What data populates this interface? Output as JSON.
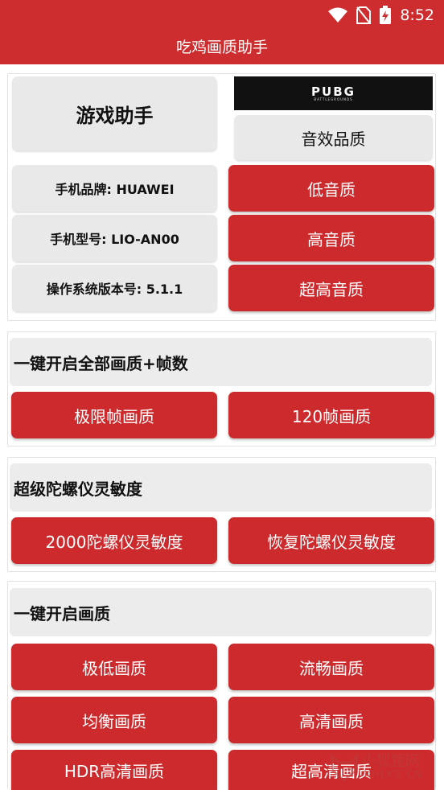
{
  "status": {
    "time": "8:52"
  },
  "app": {
    "title": "吃鸡画质助手"
  },
  "device": {
    "title": "游戏助手",
    "brand": "手机品牌: HUAWEI",
    "model": "手机型号: LIO-AN00",
    "os": "操作系统版本号: 5.1.1"
  },
  "banner": {
    "logo_text": "PUBG",
    "sub_text": "BATTLEGROUNDS"
  },
  "audio": {
    "header": "音效品质",
    "low": "低音质",
    "high": "高音质",
    "ultra": "超高音质"
  },
  "framerate": {
    "header": "一键开启全部画质+帧数",
    "extreme": "极限帧画质",
    "fps120": "120帧画质"
  },
  "gyro": {
    "header": "超级陀螺仪灵敏度",
    "set2000": "2000陀螺仪灵敏度",
    "restore": "恢复陀螺仪灵敏度"
  },
  "quality": {
    "header": "一键开启画质",
    "very_low": "极低画质",
    "smooth": "流畅画质",
    "balanced": "均衡画质",
    "hd": "高清画质",
    "hdr": "HDR高清画质",
    "ultra_hd": "超高清画质"
  },
  "watermark": {
    "line1": "小狐狸网",
    "line2": "XHLKS.CN"
  },
  "colors": {
    "primary": "#cd2d2f",
    "button_red": "#cc2a2c",
    "panel_gray": "#e9e9e9"
  }
}
